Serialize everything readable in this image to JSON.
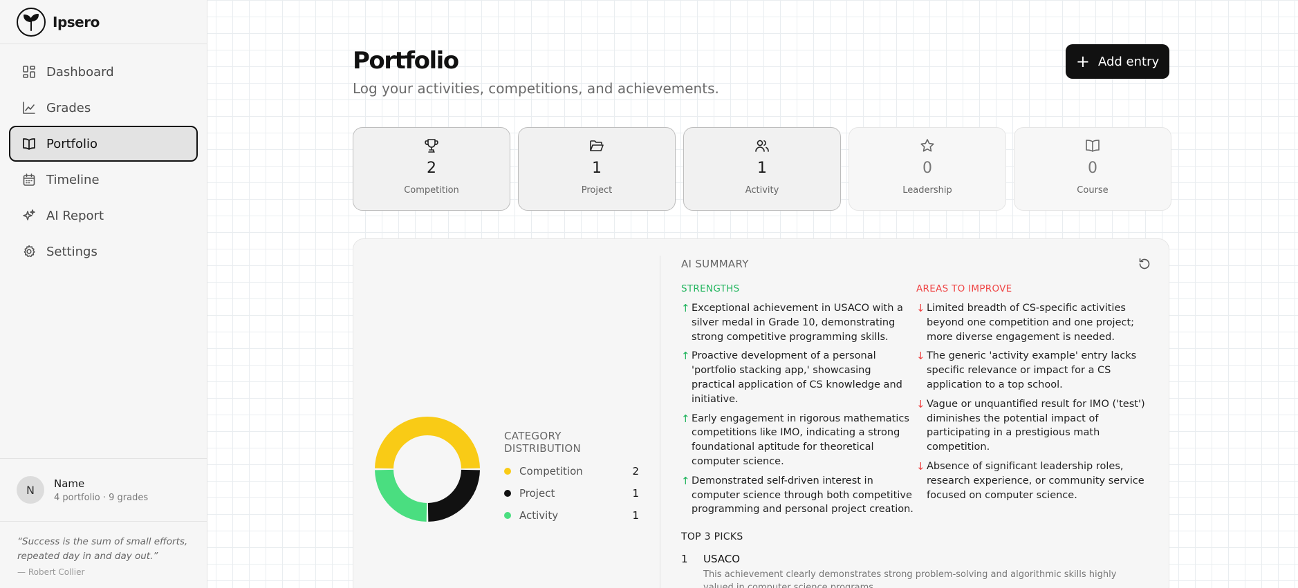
{
  "app": {
    "name": "Ipsero"
  },
  "sidebar": {
    "items": [
      {
        "label": "Dashboard",
        "icon": "dashboard-icon"
      },
      {
        "label": "Grades",
        "icon": "chart-line-icon"
      },
      {
        "label": "Portfolio",
        "icon": "book-open-icon",
        "active": true
      },
      {
        "label": "Timeline",
        "icon": "calendar-icon"
      },
      {
        "label": "AI Report",
        "icon": "sparkles-icon"
      },
      {
        "label": "Settings",
        "icon": "gear-icon"
      }
    ],
    "user": {
      "initial": "N",
      "name": "Name",
      "subtitle": "4 portfolio · 9 grades"
    },
    "quote": {
      "text": "“Success is the sum of small efforts, repeated day in and day out.”",
      "author": "— Robert Collier"
    }
  },
  "header": {
    "title": "Portfolio",
    "subtitle": "Log your activities, competitions, and achievements.",
    "add_label": "Add entry"
  },
  "stats": [
    {
      "count": "2",
      "label": "Competition",
      "icon": "trophy-icon"
    },
    {
      "count": "1",
      "label": "Project",
      "icon": "folder-open-icon"
    },
    {
      "count": "1",
      "label": "Activity",
      "icon": "users-icon"
    },
    {
      "count": "0",
      "label": "Leadership",
      "icon": "star-icon"
    },
    {
      "count": "0",
      "label": "Course",
      "icon": "book-icon"
    }
  ],
  "distribution": {
    "title": "CATEGORY DISTRIBUTION",
    "rows": [
      {
        "label": "Competition",
        "count": "2",
        "color": "#f9cb16"
      },
      {
        "label": "Project",
        "count": "1",
        "color": "#111111"
      },
      {
        "label": "Activity",
        "count": "1",
        "color": "#4ade80"
      }
    ]
  },
  "chart_data": {
    "type": "pie",
    "categories": [
      "Competition",
      "Project",
      "Activity"
    ],
    "values": [
      2,
      1,
      1
    ],
    "colors": [
      "#f9cb16",
      "#111111",
      "#4ade80"
    ],
    "title": "CATEGORY DISTRIBUTION"
  },
  "summary": {
    "title": "AI SUMMARY",
    "strengths_title": "STRENGTHS",
    "improve_title": "AREAS TO IMPROVE",
    "strengths": [
      "Exceptional achievement in USACO with a silver medal in Grade 10, demonstrating strong competitive programming skills.",
      "Proactive development of a personal 'portfolio stacking app,' showcasing practical application of CS knowledge and initiative.",
      "Early engagement in rigorous mathematics competitions like IMO, indicating a strong foundational aptitude for theoretical computer science.",
      "Demonstrated self-driven interest in computer science through both competitive programming and personal project creation."
    ],
    "improvements": [
      "Limited breadth of CS-specific activities beyond one competition and one project; more diverse engagement is needed.",
      "The generic 'activity example' entry lacks specific relevance or impact for a CS application to a top school.",
      "Vague or unquantified result for IMO ('test') diminishes the potential impact of participating in a prestigious math competition.",
      "Absence of significant leadership roles, research experience, or community service focused on computer science."
    ],
    "picks_title": "TOP 3 PICKS",
    "picks": [
      {
        "rank": "1",
        "name": "USACO",
        "desc": "This achievement clearly demonstrates strong problem-solving and algorithmic skills highly valued in computer science programs."
      }
    ]
  }
}
